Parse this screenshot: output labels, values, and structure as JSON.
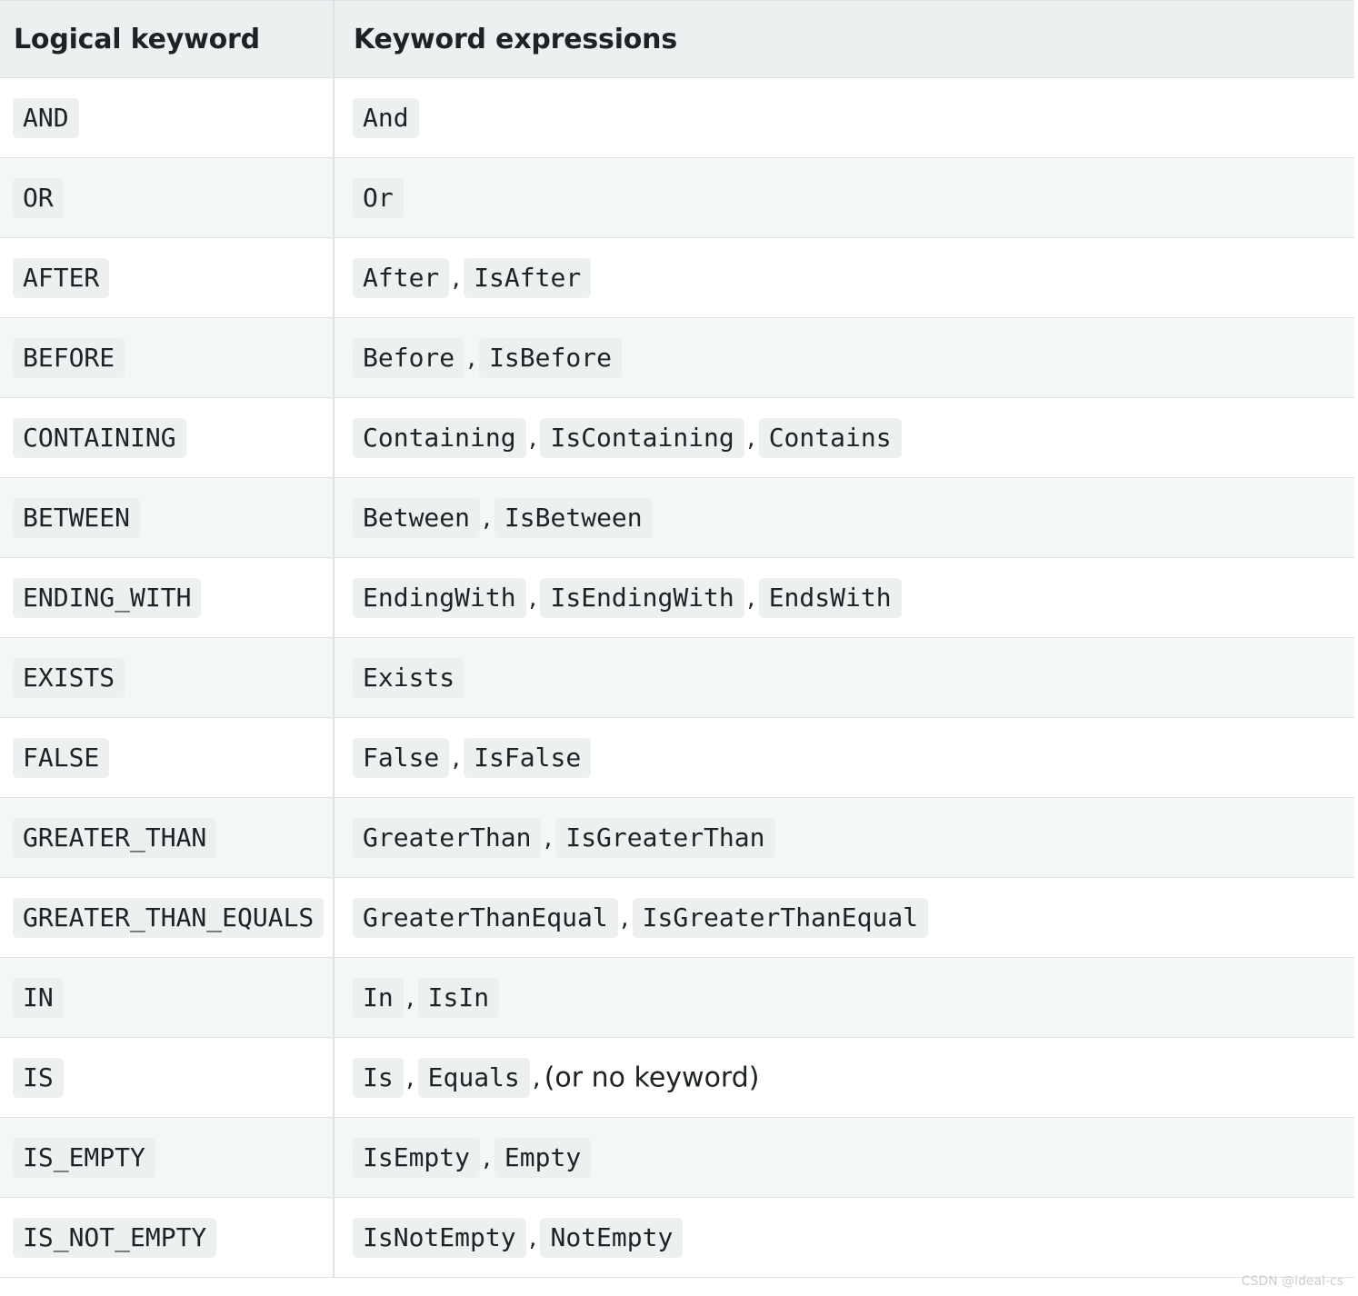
{
  "table": {
    "headers": [
      "Logical keyword",
      "Keyword expressions"
    ],
    "rows": [
      {
        "keyword": "AND",
        "expressions": [
          "And"
        ]
      },
      {
        "keyword": "OR",
        "expressions": [
          "Or"
        ]
      },
      {
        "keyword": "AFTER",
        "expressions": [
          "After",
          "IsAfter"
        ]
      },
      {
        "keyword": "BEFORE",
        "expressions": [
          "Before",
          "IsBefore"
        ]
      },
      {
        "keyword": "CONTAINING",
        "expressions": [
          "Containing",
          "IsContaining",
          "Contains"
        ]
      },
      {
        "keyword": "BETWEEN",
        "expressions": [
          "Between",
          "IsBetween"
        ]
      },
      {
        "keyword": "ENDING_WITH",
        "expressions": [
          "EndingWith",
          "IsEndingWith",
          "EndsWith"
        ]
      },
      {
        "keyword": "EXISTS",
        "expressions": [
          "Exists"
        ]
      },
      {
        "keyword": "FALSE",
        "expressions": [
          "False",
          "IsFalse"
        ]
      },
      {
        "keyword": "GREATER_THAN",
        "expressions": [
          "GreaterThan",
          "IsGreaterThan"
        ]
      },
      {
        "keyword": "GREATER_THAN_EQUALS",
        "expressions": [
          "GreaterThanEqual",
          "IsGreaterThanEqual"
        ]
      },
      {
        "keyword": "IN",
        "expressions": [
          "In",
          "IsIn"
        ]
      },
      {
        "keyword": "IS",
        "expressions": [
          "Is",
          "Equals"
        ],
        "note": "(or no keyword)"
      },
      {
        "keyword": "IS_EMPTY",
        "expressions": [
          "IsEmpty",
          "Empty"
        ]
      },
      {
        "keyword": "IS_NOT_EMPTY",
        "expressions": [
          "IsNotEmpty",
          "NotEmpty"
        ]
      }
    ]
  },
  "separator": ",",
  "watermark": {
    "bottom": "CSDN @ideal-cs"
  }
}
